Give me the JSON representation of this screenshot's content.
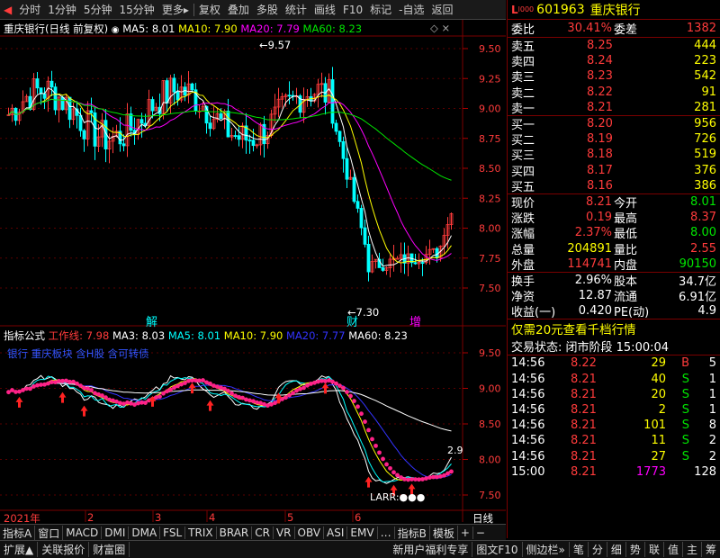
{
  "toolbar": {
    "items": [
      "分时",
      "1分钟",
      "5分钟",
      "15分钟",
      "更多",
      "复权",
      "叠加",
      "多股",
      "统计",
      "画线",
      "F10",
      "标记",
      "-自选",
      "返回"
    ]
  },
  "kline_header": {
    "title": "重庆银行(日线 前复权)",
    "ma5": "MA5: 8.01",
    "ma10": "MA10: 7.90",
    "ma20": "MA20: 7.79",
    "ma60": "MA60: 8.23"
  },
  "kline_axis": [
    "9.50",
    "9.25",
    "9.00",
    "8.75",
    "8.50",
    "8.25",
    "8.00",
    "7.75",
    "7.50"
  ],
  "kline_marks": {
    "high": "9.57",
    "low": "7.30",
    "jie": "解",
    "cai": "财",
    "zeng": "增"
  },
  "indicator_header": {
    "name": "指标公式",
    "work_label": "工作线:",
    "work_value": "7.98",
    "ma3": "MA3: 8.03",
    "ma5": "MA5: 8.01",
    "ma10": "MA10: 7.90",
    "ma20": "MA20: 7.77",
    "ma60": "MA60: 8.23",
    "subtitle": "银行 重庆板块 含H股 含可转债"
  },
  "indicator_axis": [
    "9.50",
    "9.00",
    "8.50",
    "8.00",
    "7.50"
  ],
  "indicator_marks": {
    "value": "2.9",
    "larr": "LARR:●●●"
  },
  "date_axis": {
    "year": "2021年",
    "months": [
      "2",
      "3",
      "4",
      "5",
      "6"
    ],
    "period": "日线"
  },
  "bottom_tabs": [
    "指标A",
    "窗口",
    "MACD",
    "DMI",
    "DMA",
    "FSL",
    "TRIX",
    "BRAR",
    "CR",
    "VR",
    "OBV",
    "ASI",
    "EMV",
    "…",
    "指标B",
    "模板"
  ],
  "status_tabs": [
    "扩展",
    "关联报价",
    "财富圈"
  ],
  "status_right": [
    "新用户福利专享",
    "图文F10",
    "侧边栏"
  ],
  "side_tabs": [
    "笔",
    "分",
    "细",
    "势",
    "联",
    "值",
    "主",
    "筹"
  ],
  "quote": {
    "code": "601963",
    "name": "重庆银行",
    "weibi_label": "委比",
    "weibi": "30.41%",
    "weicha_label": "委差",
    "weicha": "1382",
    "asks": [
      {
        "label": "卖五",
        "price": "8.25",
        "vol": "444"
      },
      {
        "label": "卖四",
        "price": "8.24",
        "vol": "223"
      },
      {
        "label": "卖三",
        "price": "8.23",
        "vol": "542"
      },
      {
        "label": "卖二",
        "price": "8.22",
        "vol": "91"
      },
      {
        "label": "卖一",
        "price": "8.21",
        "vol": "281"
      }
    ],
    "bids": [
      {
        "label": "买一",
        "price": "8.20",
        "vol": "956"
      },
      {
        "label": "买二",
        "price": "8.19",
        "vol": "726"
      },
      {
        "label": "买三",
        "price": "8.18",
        "vol": "519"
      },
      {
        "label": "买四",
        "price": "8.17",
        "vol": "376"
      },
      {
        "label": "买五",
        "price": "8.16",
        "vol": "386"
      }
    ],
    "stats": [
      {
        "l1": "现价",
        "v1": "8.21",
        "l2": "今开",
        "v2": "8.01"
      },
      {
        "l1": "涨跌",
        "v1": "0.19",
        "l2": "最高",
        "v2": "8.37"
      },
      {
        "l1": "涨幅",
        "v1": "2.37%",
        "l2": "最低",
        "v2": "8.00"
      },
      {
        "l1": "总量",
        "v1": "204891",
        "l2": "量比",
        "v2": "2.55"
      },
      {
        "l1": "外盘",
        "v1": "114741",
        "l2": "内盘",
        "v2": "90150"
      }
    ],
    "stats2": [
      {
        "l1": "换手",
        "v1": "2.96%",
        "l2": "股本",
        "v2": "34.7亿"
      },
      {
        "l1": "净资",
        "v1": "12.87",
        "l2": "流通",
        "v2": "6.91亿"
      },
      {
        "l1": "收益(一)",
        "v1": "0.420",
        "l2": "PE(动)",
        "v2": "4.9"
      }
    ],
    "promo": "仅需20元查看千档行情",
    "trade_status": "交易状态: 闭市阶段 15:00:04",
    "ticks": [
      {
        "t": "14:56",
        "p": "8.22",
        "v": "29",
        "d": "B",
        "n": "5"
      },
      {
        "t": "14:56",
        "p": "8.21",
        "v": "40",
        "d": "S",
        "n": "1"
      },
      {
        "t": "14:56",
        "p": "8.21",
        "v": "20",
        "d": "S",
        "n": "1"
      },
      {
        "t": "14:56",
        "p": "8.21",
        "v": "2",
        "d": "S",
        "n": "1"
      },
      {
        "t": "14:56",
        "p": "8.21",
        "v": "101",
        "d": "S",
        "n": "8"
      },
      {
        "t": "14:56",
        "p": "8.21",
        "v": "11",
        "d": "S",
        "n": "2"
      },
      {
        "t": "14:56",
        "p": "8.21",
        "v": "27",
        "d": "S",
        "n": "2"
      },
      {
        "t": "15:00",
        "p": "8.21",
        "v": "1773",
        "d": "",
        "n": "128"
      }
    ]
  }
}
